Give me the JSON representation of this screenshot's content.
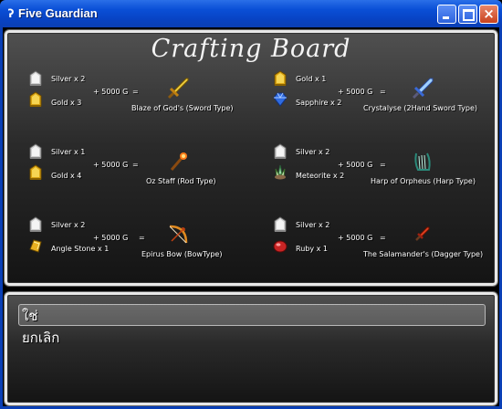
{
  "window": {
    "title": "Five Guardian"
  },
  "board": {
    "title": "Crafting Board",
    "recipes": [
      {
        "ingredients": [
          {
            "label": "Silver x 2",
            "icon": "silver-ingot"
          },
          {
            "label": "Gold x 3",
            "icon": "gold-ingot"
          }
        ],
        "cost": "+ 5000 G",
        "equals": "=",
        "result": {
          "label": "Blaze of God's (Sword Type)",
          "icon": "golden-sword"
        }
      },
      {
        "ingredients": [
          {
            "label": "Gold x 1",
            "icon": "gold-ingot"
          },
          {
            "label": "Sapphire x 2",
            "icon": "sapphire-gem"
          }
        ],
        "cost": "+ 5000 G",
        "equals": "=",
        "result": {
          "label": "Crystalyse  (2Hand Sword Type)",
          "icon": "crystal-sword"
        }
      },
      {
        "ingredients": [
          {
            "label": "Silver x 1",
            "icon": "silver-ingot"
          },
          {
            "label": "Gold x 4",
            "icon": "gold-ingot"
          }
        ],
        "cost": "+ 5000 G",
        "equals": "=",
        "result": {
          "label": "Oz Staff (Rod Type)",
          "icon": "fire-rod"
        }
      },
      {
        "ingredients": [
          {
            "label": "Silver x 2",
            "icon": "silver-ingot"
          },
          {
            "label": "Meteorite x 2",
            "icon": "meteorite-crystal"
          }
        ],
        "cost": "+ 5000 G",
        "equals": "=",
        "result": {
          "label": "Harp of Orpheus (Harp Type)",
          "icon": "harp"
        }
      },
      {
        "ingredients": [
          {
            "label": "Silver x 2",
            "icon": "silver-ingot"
          },
          {
            "label": "Angle Stone x 1",
            "icon": "angle-stone"
          }
        ],
        "cost": "+ 5000 G",
        "equals": "=",
        "result": {
          "label": "Epirus Bow  (BowType)",
          "icon": "bow"
        }
      },
      {
        "ingredients": [
          {
            "label": "Silver x 2",
            "icon": "silver-ingot"
          },
          {
            "label": "Ruby x 1",
            "icon": "ruby-gem"
          }
        ],
        "cost": "+ 5000 G",
        "equals": "=",
        "result": {
          "label": "The Salamander's  (Dagger Type)",
          "icon": "red-dagger"
        }
      }
    ]
  },
  "choices": {
    "options": [
      "ใช่",
      "ยกเลิก"
    ],
    "selected_index": 0
  },
  "colors": {
    "titlebar": "#0a4fd6",
    "silver": "#d8d8d8",
    "gold": "#e8b820",
    "sapphire": "#3a78f0",
    "ruby": "#d02828"
  }
}
